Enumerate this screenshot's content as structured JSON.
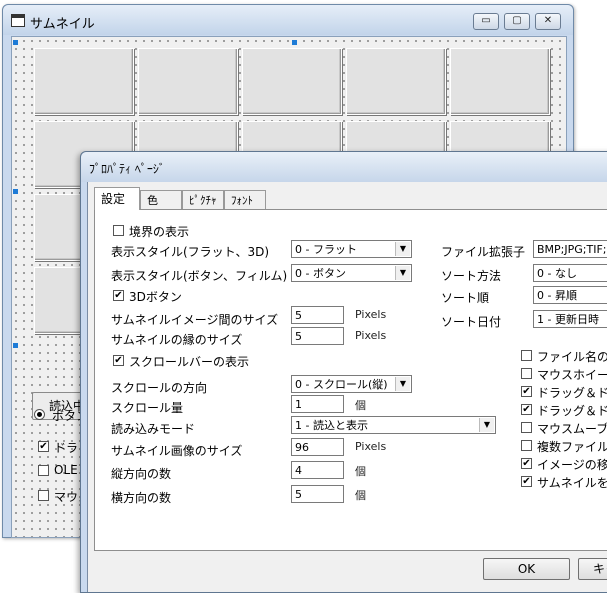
{
  "back_window": {
    "title": "サムネイル",
    "controls": {
      "minimize": "▭",
      "maximize": "▢",
      "close": "✕"
    },
    "button_label": "読込中",
    "radio_label": "ボタン",
    "checks": [
      {
        "label": "ドラッ",
        "checked": "✔"
      },
      {
        "label": "OLE",
        "checked": ""
      },
      {
        "label": "マウス",
        "checked": ""
      }
    ]
  },
  "dialog": {
    "title": "ﾌﾟﾛﾊﾟﾃｨ ﾍﾟｰｼﾞ",
    "tabs": [
      "設定",
      "色",
      "ﾋﾟｸﾁｬ",
      "ﾌｫﾝﾄ"
    ],
    "left": {
      "border_display": {
        "label": "境界の表示",
        "checked": ""
      },
      "display_style_flat": {
        "label": "表示スタイル(フラット、3D)",
        "value": "0 - フラット"
      },
      "display_style_button": {
        "label": "表示スタイル(ボタン、フィルム)",
        "value": "0 - ボタン"
      },
      "button_3d": {
        "label": "3Dボタン",
        "checked": "✔"
      },
      "image_spacing": {
        "label": "サムネイルイメージ間のサイズ",
        "value": "5",
        "unit": "Pixels"
      },
      "edge_size": {
        "label": "サムネイルの縁のサイズ",
        "value": "5",
        "unit": "Pixels"
      },
      "scrollbar_display": {
        "label": "スクロールバーの表示",
        "checked": "✔"
      },
      "scroll_direction": {
        "label": "スクロールの方向",
        "value": "0 - スクロール(縦)"
      },
      "scroll_amount": {
        "label": "スクロール量",
        "value": "1",
        "unit": "個"
      },
      "load_mode": {
        "label": "読み込みモード",
        "value": "1 - 読込と表示"
      },
      "image_size": {
        "label": "サムネイル画像のサイズ",
        "value": "96",
        "unit": "Pixels"
      },
      "rows": {
        "label": "縦方向の数",
        "value": "4",
        "unit": "個"
      },
      "cols": {
        "label": "横方向の数",
        "value": "5",
        "unit": "個"
      }
    },
    "right": {
      "file_ext": {
        "label": "ファイル拡張子",
        "value": "BMP;JPG;TIF;P"
      },
      "sort_method": {
        "label": "ソート方法",
        "value": "0 - なし"
      },
      "sort_order": {
        "label": "ソート順",
        "value": "0 - 昇順"
      },
      "sort_date": {
        "label": "ソート日付",
        "value": "1 - 更新日時"
      },
      "checks": [
        {
          "label": "ファイル名の表",
          "checked": ""
        },
        {
          "label": "マウスホイール",
          "checked": ""
        },
        {
          "label": "ドラッグ＆ドロッ",
          "checked": "✔"
        },
        {
          "label": "ドラッグ＆ドロッ",
          "checked": "✔"
        },
        {
          "label": "マウスムーブの",
          "checked": ""
        },
        {
          "label": "複数ファイルの",
          "checked": ""
        },
        {
          "label": "イメージの移動",
          "checked": "✔"
        },
        {
          "label": "サムネイルをク",
          "checked": "✔"
        }
      ]
    },
    "buttons": {
      "ok": "OK",
      "cancel": "キャ"
    }
  }
}
